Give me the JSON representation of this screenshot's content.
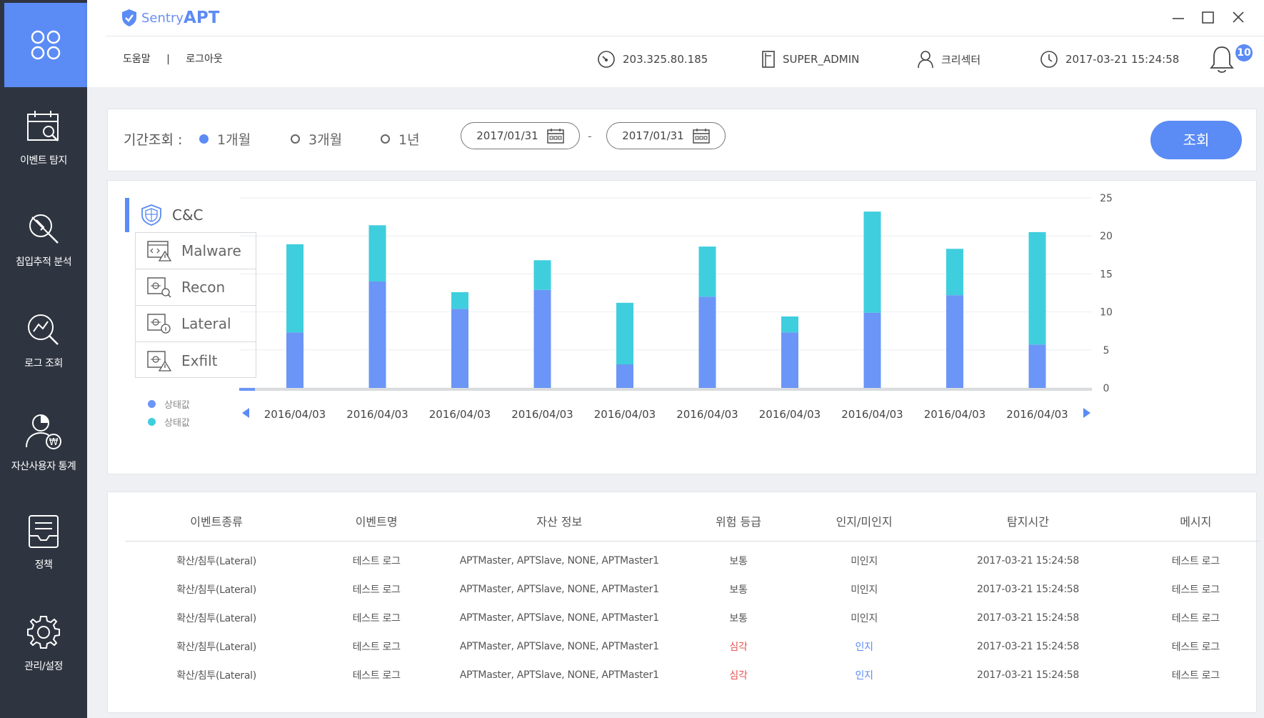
{
  "app": {
    "brand_prefix": "Sentry",
    "brand_main": "APT"
  },
  "header": {
    "help": "도움말",
    "separator": "|",
    "logout": "로그아웃",
    "ip": "203.325.80.185",
    "role": "SUPER_ADMIN",
    "user": "크리섹터",
    "datetime": "2017-03-21 15:24:58",
    "notification_count": "10"
  },
  "sidebar": {
    "items": [
      {
        "label": "이벤트 탐지",
        "icon": "calendar-search-icon"
      },
      {
        "label": "침입추적 분석",
        "icon": "trace-analysis-icon"
      },
      {
        "label": "로그 조회",
        "icon": "log-search-icon"
      },
      {
        "label": "자산사용자 통계",
        "icon": "user-asset-icon"
      },
      {
        "label": "정책",
        "icon": "policy-inbox-icon"
      },
      {
        "label": "관리/설정",
        "icon": "gear-icon"
      }
    ]
  },
  "filter": {
    "label": "기간조회 :",
    "options": [
      "1개월",
      "3개월",
      "1년"
    ],
    "selected": "1개월",
    "date_from": "2017/01/31",
    "date_to": "2017/01/31",
    "dash": "-",
    "query_button": "조회"
  },
  "categories": {
    "active": "C&C",
    "items": [
      "Malware",
      "Recon",
      "Lateral",
      "Exfilt"
    ]
  },
  "legend": [
    {
      "name": "상태값",
      "color": "#6b95f6"
    },
    {
      "name": "상태값",
      "color": "#3fcedd"
    }
  ],
  "chart_data": {
    "type": "bar",
    "stacked": true,
    "categories": [
      "2016/04/03",
      "2016/04/03",
      "2016/04/03",
      "2016/04/03",
      "2016/04/03",
      "2016/04/03",
      "2016/04/03",
      "2016/04/03",
      "2016/04/03",
      "2016/04/03"
    ],
    "series": [
      {
        "name": "상태값",
        "color": "#6b95f6",
        "values": [
          7.3,
          14,
          10.4,
          12.9,
          3.1,
          12,
          7.3,
          9.9,
          12.2,
          5.7
        ]
      },
      {
        "name": "상태값",
        "color": "#3fcedd",
        "values": [
          11.6,
          7.4,
          2.2,
          3.9,
          8.1,
          6.6,
          2.1,
          13.3,
          6.1,
          14.8
        ]
      }
    ],
    "yticks": [
      0,
      5,
      10,
      15,
      20,
      25
    ],
    "ylim": [
      0,
      25
    ],
    "y_axis_position": "right",
    "grid": true
  },
  "table": {
    "headers": [
      "이벤트종류",
      "이벤트명",
      "자산 정보",
      "위험 등급",
      "인지/미인지",
      "탐지시간",
      "메시지"
    ],
    "rows": [
      [
        "확산/침투(Lateral)",
        "테스트 로그",
        "APTMaster, APTSlave, NONE, APTMaster1",
        "보통",
        "미인지",
        "2017-03-21 15:24:58",
        "테스트 로그"
      ],
      [
        "확산/침투(Lateral)",
        "테스트 로그",
        "APTMaster, APTSlave, NONE, APTMaster1",
        "보통",
        "미인지",
        "2017-03-21 15:24:58",
        "테스트 로그"
      ],
      [
        "확산/침투(Lateral)",
        "테스트 로그",
        "APTMaster, APTSlave, NONE, APTMaster1",
        "보통",
        "미인지",
        "2017-03-21 15:24:58",
        "테스트 로그"
      ],
      [
        "확산/침투(Lateral)",
        "테스트 로그",
        "APTMaster, APTSlave, NONE, APTMaster1",
        "심각",
        "인지",
        "2017-03-21 15:24:58",
        "테스트 로그"
      ],
      [
        "확산/침투(Lateral)",
        "테스트 로그",
        "APTMaster, APTSlave, NONE, APTMaster1",
        "심각",
        "인지",
        "2017-03-21 15:24:58",
        "테스트 로그"
      ]
    ],
    "severe_color": "#e8504f",
    "aware_color": "#5b8bf4"
  }
}
